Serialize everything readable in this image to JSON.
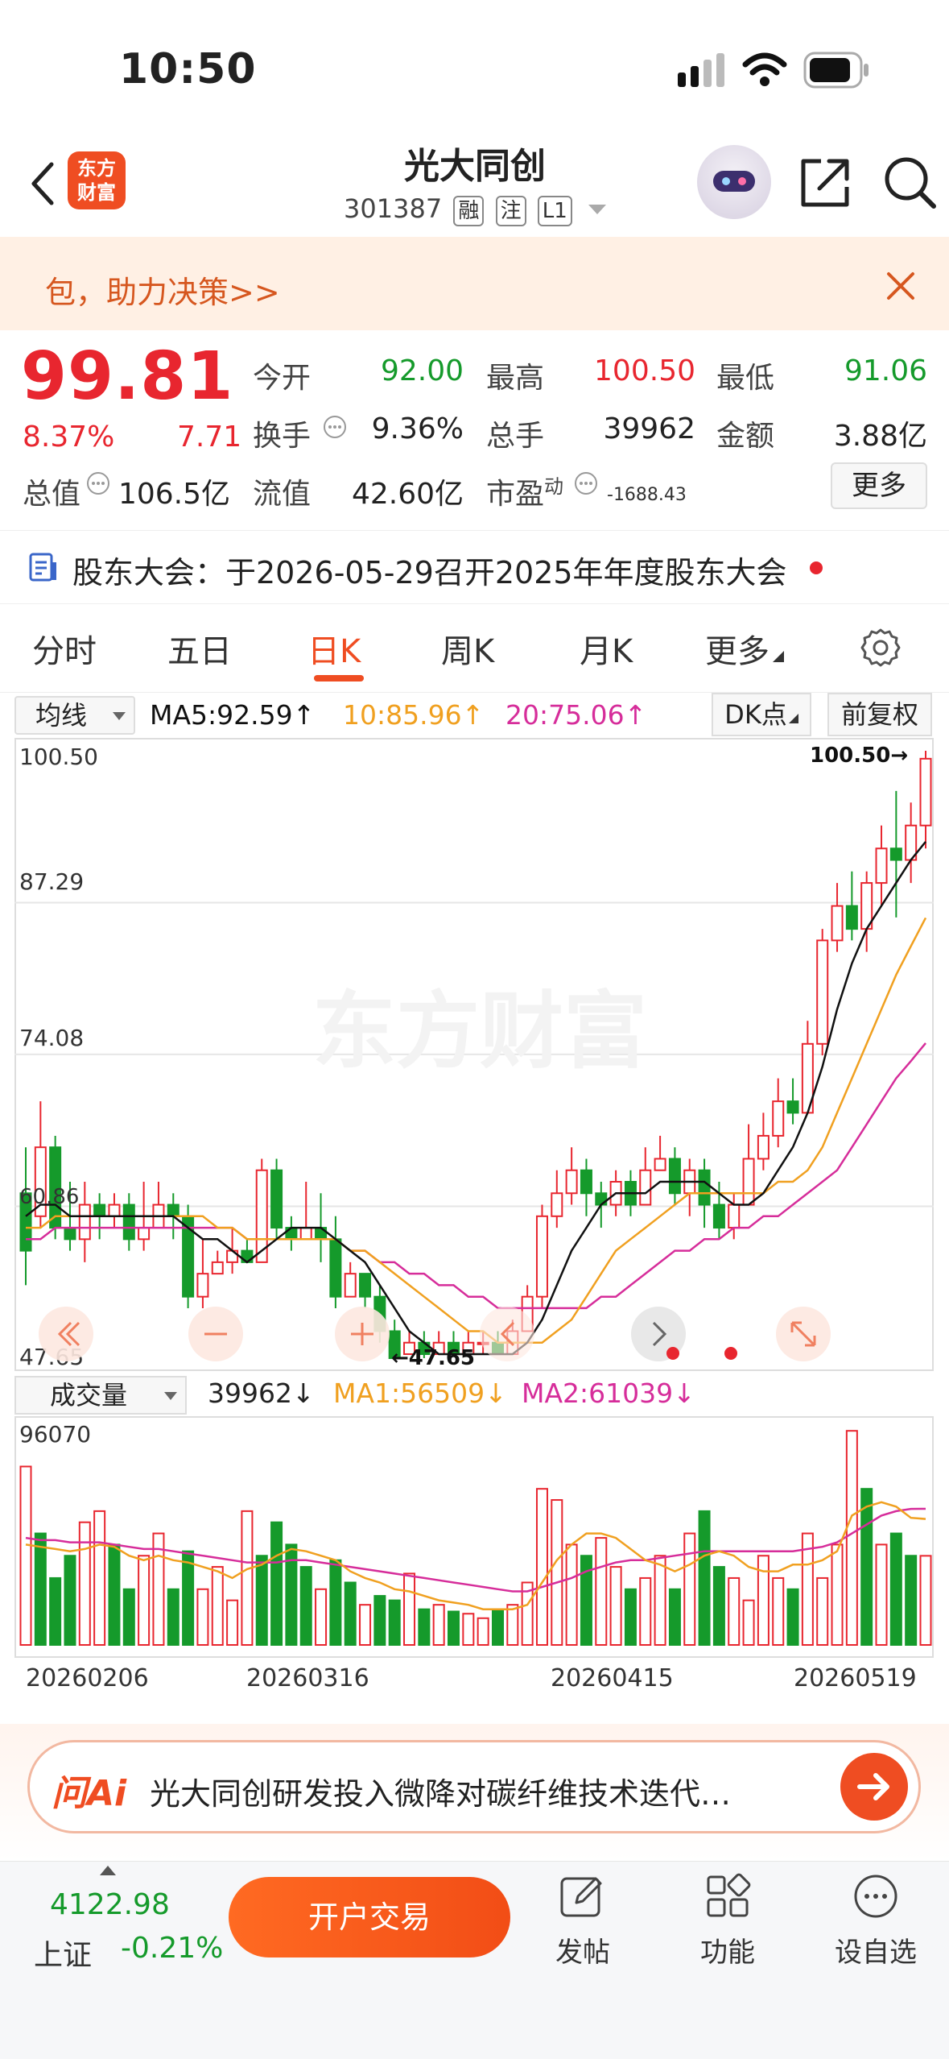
{
  "status": {
    "time": "10:50"
  },
  "header": {
    "title": "光大同创",
    "code": "301387",
    "tags": [
      "融",
      "注",
      "L1"
    ],
    "brand": [
      "东方",
      "财富"
    ]
  },
  "banner": {
    "text": "包，助力决策>>"
  },
  "quote": {
    "price": "99.81",
    "change_pct": "8.37%",
    "change_abs": "7.71",
    "fields": [
      {
        "label": "今开",
        "value": "92.00",
        "color": "green"
      },
      {
        "label": "最高",
        "value": "100.50",
        "color": "red"
      },
      {
        "label": "最低",
        "value": "91.06",
        "color": "green"
      },
      {
        "label": "换手",
        "value": "9.36%",
        "color": "dark"
      },
      {
        "label": "总手",
        "value": "39962",
        "color": "dark"
      },
      {
        "label": "金额",
        "value": "3.88亿",
        "color": "dark"
      }
    ],
    "total_value_label": "总值",
    "total_value": "106.5亿",
    "float_value_label": "流值",
    "float_value": "42.60亿",
    "pe_label": "市盈",
    "pe_sup": "动",
    "pe_value": "-1688.43",
    "more_label": "更多"
  },
  "notice": {
    "text": "股东大会：于2026-05-29召开2025年年度股东大会"
  },
  "tabs": [
    "分时",
    "五日",
    "日K",
    "周K",
    "月K",
    "更多"
  ],
  "active_tab": "日K",
  "ma": {
    "select_label": "均线",
    "ma5": "MA5:92.59↑",
    "ma10": "10:85.96↑",
    "ma20": "20:75.06↑",
    "dk_label": "DK点",
    "fq_label": "前复权"
  },
  "chart_labels": {
    "y_top": "100.50",
    "y_2": "87.29",
    "y_3": "74.08",
    "y_bottom": "47.65",
    "y_left_mark": "60.86",
    "high_mark": "100.50→",
    "low_mark": "←47.65",
    "watermark": "东方财富"
  },
  "volume": {
    "select_label": "成交量",
    "current": "39962↓",
    "ma1": "MA1:56509↓",
    "ma2": "MA2:61039↓",
    "y_top": "96070",
    "dates": [
      "20260206",
      "20260316",
      "20260415",
      "20260519"
    ]
  },
  "ai": {
    "logo": "问Ai",
    "text": "光大同创研发投入微降对碳纤维技术迭代…"
  },
  "bottom": {
    "index_value": "4122.98",
    "index_name": "上证",
    "index_change": "-0.21%",
    "trade_label": "开户交易",
    "nav": [
      "发帖",
      "功能",
      "设自选"
    ]
  },
  "colors": {
    "up": "#e8262f",
    "down": "#159a2b",
    "accent": "#ef4d22",
    "ma5": "#111111",
    "ma10": "#f0a020",
    "ma20": "#d62d9a"
  },
  "chart_data": {
    "type": "candlestick",
    "ylim": [
      47.65,
      100.5
    ],
    "candles": [
      [
        62,
        57,
        66,
        54
      ],
      [
        60,
        66,
        70,
        59
      ],
      [
        66,
        59,
        67,
        58
      ],
      [
        59,
        58,
        63,
        57
      ],
      [
        58,
        61,
        63,
        56
      ],
      [
        61,
        60,
        62,
        58
      ],
      [
        60,
        61,
        62,
        59
      ],
      [
        61,
        58,
        62,
        57
      ],
      [
        58,
        59,
        63,
        57
      ],
      [
        59,
        61,
        63,
        59
      ],
      [
        61,
        60,
        62,
        58
      ],
      [
        60,
        53,
        61,
        52
      ],
      [
        53,
        55,
        58,
        52
      ],
      [
        55,
        56,
        57,
        55
      ],
      [
        56,
        57,
        59,
        55
      ],
      [
        57,
        56,
        58,
        56
      ],
      [
        56,
        64,
        65,
        56
      ],
      [
        64,
        59,
        65,
        58
      ],
      [
        59,
        58,
        60,
        57
      ],
      [
        58,
        59,
        63,
        58
      ],
      [
        59,
        58,
        62,
        56
      ],
      [
        58,
        53,
        60,
        52
      ],
      [
        53,
        55,
        56,
        53
      ],
      [
        55,
        53,
        55,
        52
      ],
      [
        53,
        50,
        54,
        49
      ],
      [
        50,
        47.65,
        51,
        47.65
      ],
      [
        48,
        49,
        50,
        48
      ],
      [
        49,
        48,
        50,
        47.65
      ],
      [
        48,
        49,
        50,
        48
      ],
      [
        49,
        48,
        50,
        47.8
      ],
      [
        48,
        49,
        50,
        48
      ],
      [
        49,
        49,
        50,
        48
      ],
      [
        49,
        48,
        50,
        48
      ],
      [
        48,
        50,
        51,
        48
      ],
      [
        50,
        53,
        54,
        50
      ],
      [
        53,
        60,
        61,
        52
      ],
      [
        60,
        62,
        64,
        59
      ],
      [
        62,
        64,
        66,
        61
      ],
      [
        64,
        62,
        65,
        60
      ],
      [
        62,
        61,
        63,
        59
      ],
      [
        61,
        63,
        64,
        60
      ],
      [
        63,
        61,
        64,
        60
      ],
      [
        61,
        64,
        66,
        61
      ],
      [
        64,
        65,
        67,
        64
      ],
      [
        65,
        62,
        66,
        61
      ],
      [
        62,
        64,
        65,
        60
      ],
      [
        64,
        61,
        65,
        59
      ],
      [
        61,
        59,
        63,
        58
      ],
      [
        59,
        61,
        62,
        58
      ],
      [
        61,
        65,
        68,
        61
      ],
      [
        65,
        67,
        69,
        64
      ],
      [
        67,
        70,
        72,
        66
      ],
      [
        70,
        69,
        72,
        68
      ],
      [
        69,
        75,
        77,
        69
      ],
      [
        75,
        84,
        85,
        74
      ],
      [
        84,
        87,
        89,
        83
      ],
      [
        87,
        85,
        90,
        84
      ],
      [
        85,
        89,
        90,
        83
      ],
      [
        89,
        92,
        94,
        87
      ],
      [
        92,
        91,
        97,
        86
      ],
      [
        91,
        94,
        96,
        89
      ],
      [
        94,
        99.81,
        100.5,
        92
      ]
    ],
    "ma5": [
      60,
      61,
      61,
      60,
      60,
      60,
      60,
      60,
      60,
      60,
      60,
      59,
      58,
      58,
      57,
      56,
      57,
      58,
      59,
      59,
      59,
      58,
      57,
      56,
      54,
      52,
      50,
      49,
      48,
      48,
      48,
      48,
      48,
      48,
      49,
      51,
      54,
      57,
      59,
      61,
      62,
      62,
      62,
      63,
      63,
      63,
      63,
      62,
      61,
      61,
      62,
      64,
      66,
      69,
      73,
      78,
      82,
      85,
      87,
      89,
      91,
      92.59
    ],
    "ma10": [
      59,
      59,
      60,
      60,
      60,
      60,
      60,
      60,
      60,
      60,
      60,
      60,
      60,
      59,
      59,
      58,
      58,
      58,
      58,
      58,
      58,
      58,
      57,
      57,
      56,
      55,
      54,
      53,
      52,
      51,
      50,
      50,
      49,
      49,
      49,
      49,
      50,
      51,
      53,
      55,
      57,
      58,
      59,
      60,
      61,
      62,
      62,
      62,
      62,
      62,
      62,
      63,
      63,
      64,
      66,
      69,
      72,
      75,
      78,
      81,
      83.5,
      85.96
    ],
    "ma20": [
      58,
      58,
      59,
      59,
      59,
      59,
      59,
      59,
      59,
      59,
      59,
      59,
      59,
      59,
      59,
      58,
      58,
      58,
      58,
      58,
      58,
      58,
      57,
      57,
      56,
      56,
      55,
      55,
      54,
      54,
      53,
      53,
      52,
      52,
      52,
      52,
      52,
      52,
      52,
      53,
      53,
      54,
      55,
      56,
      57,
      57,
      58,
      58,
      59,
      59,
      60,
      60,
      61,
      62,
      63,
      64,
      66,
      68,
      70,
      72,
      73.5,
      75.06
    ],
    "volume": [
      80,
      50,
      30,
      40,
      55,
      60,
      45,
      25,
      40,
      50,
      25,
      42,
      25,
      35,
      20,
      60,
      40,
      55,
      45,
      35,
      25,
      38,
      28,
      18,
      22,
      20,
      32,
      16,
      18,
      15,
      14,
      12,
      16,
      18,
      28,
      70,
      65,
      45,
      40,
      48,
      35,
      25,
      30,
      40,
      25,
      50,
      60,
      35,
      30,
      20,
      40,
      30,
      25,
      50,
      30,
      45,
      96,
      70,
      45,
      50,
      40,
      39.962
    ],
    "vol_up": [
      true,
      false,
      false,
      false,
      true,
      true,
      false,
      false,
      true,
      true,
      false,
      false,
      true,
      true,
      true,
      true,
      false,
      false,
      false,
      false,
      true,
      false,
      false,
      true,
      false,
      false,
      true,
      false,
      true,
      false,
      true,
      true,
      false,
      true,
      true,
      true,
      true,
      true,
      false,
      true,
      true,
      false,
      true,
      true,
      false,
      true,
      false,
      false,
      true,
      true,
      true,
      true,
      false,
      true,
      true,
      true,
      true,
      false,
      true,
      false,
      false,
      true
    ],
    "vol_ma1": [
      45,
      44,
      43,
      42,
      43,
      45,
      44,
      40,
      38,
      40,
      38,
      37,
      35,
      33,
      30,
      34,
      36,
      40,
      43,
      42,
      40,
      38,
      33,
      30,
      28,
      25,
      24,
      22,
      20,
      19,
      18,
      16,
      16,
      16,
      18,
      28,
      38,
      45,
      50,
      50,
      48,
      43,
      38,
      36,
      33,
      36,
      40,
      42,
      40,
      35,
      33,
      33,
      36,
      36,
      38,
      42,
      58,
      62,
      64,
      62,
      57,
      56.5
    ],
    "vol_ma2": [
      48,
      47,
      47,
      46,
      46,
      46,
      45,
      44,
      43,
      43,
      42,
      41,
      40,
      39,
      38,
      37,
      37,
      37,
      38,
      38,
      37,
      36,
      35,
      34,
      33,
      32,
      31,
      30,
      29,
      28,
      27,
      26,
      25,
      24,
      24,
      26,
      28,
      30,
      33,
      35,
      37,
      38,
      38,
      39,
      40,
      41,
      42,
      42,
      42,
      42,
      42,
      42,
      42,
      43,
      44,
      46,
      50,
      54,
      58,
      60,
      61,
      61.04
    ],
    "vol_ylim": [
      0,
      96.07
    ]
  }
}
